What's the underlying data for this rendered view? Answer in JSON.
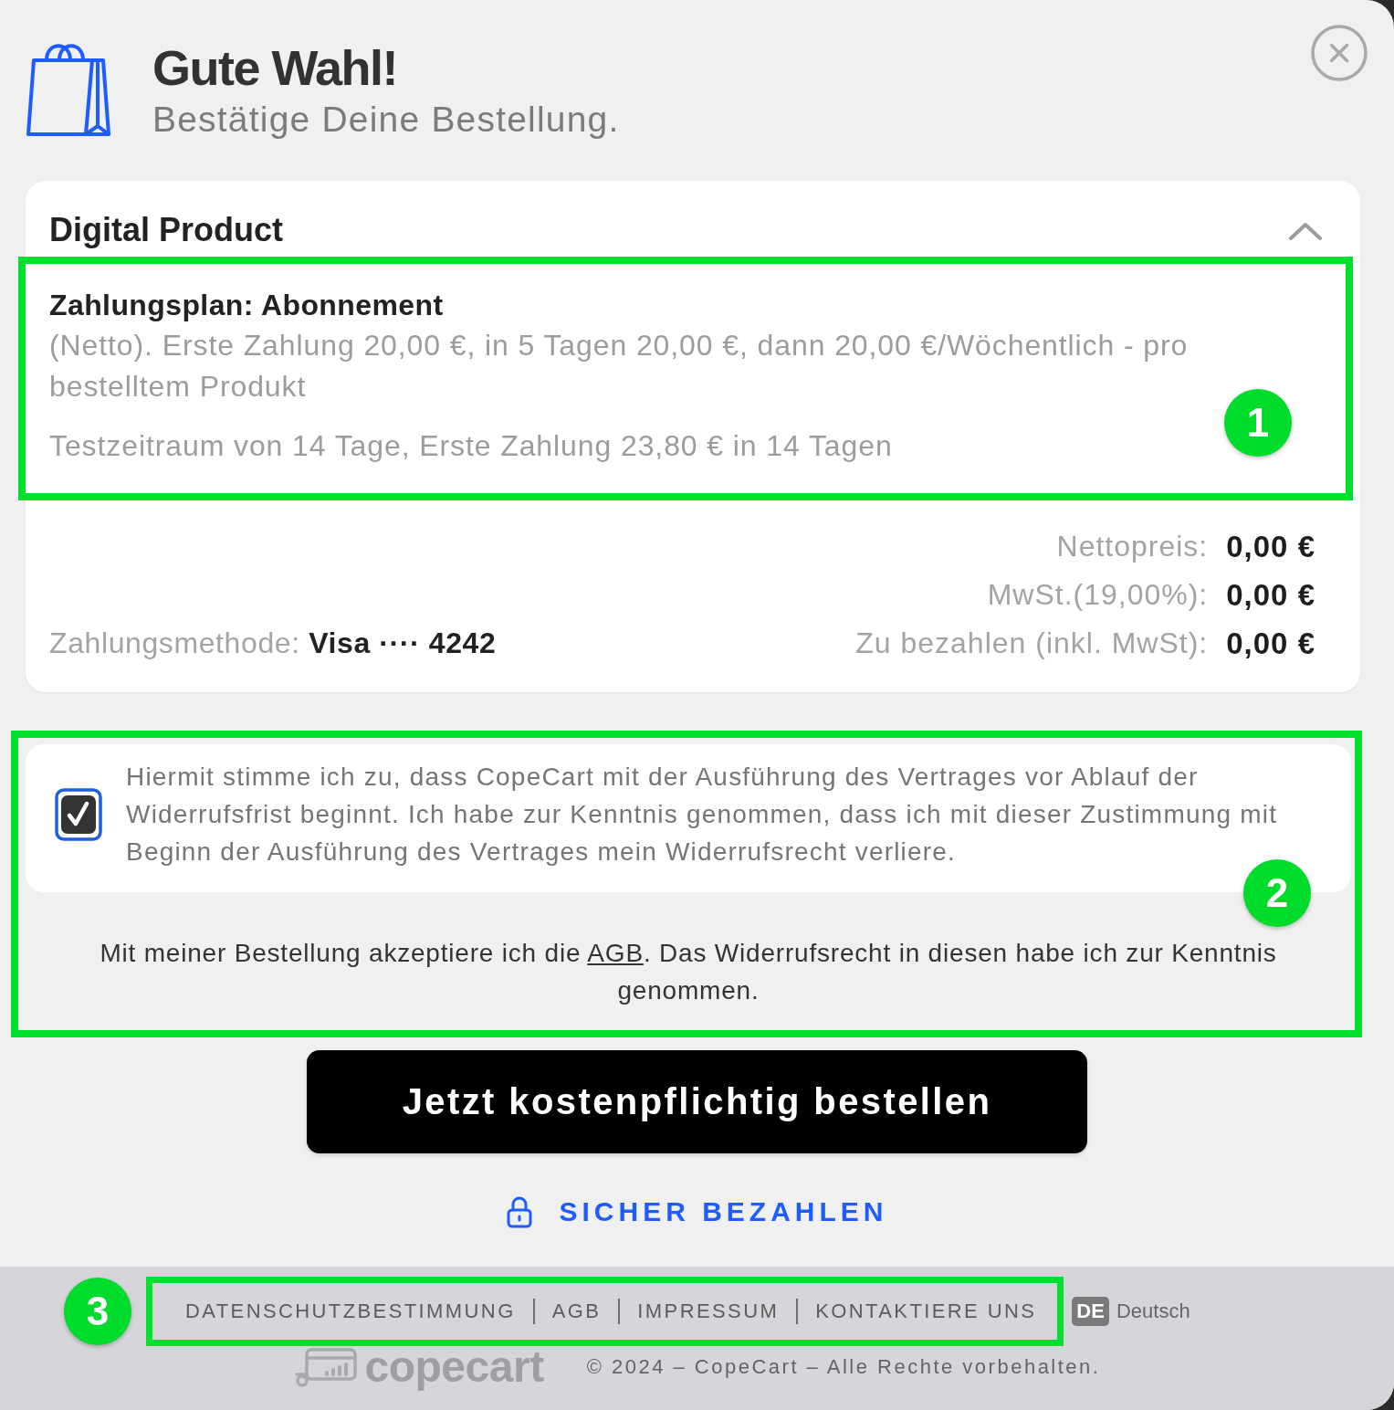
{
  "header": {
    "title": "Gute Wahl!",
    "subtitle": "Bestätige Deine Bestellung."
  },
  "product": {
    "name": "Digital Product",
    "expanded": true,
    "plan": {
      "callout": "1",
      "title": "Zahlungsplan: Abonnement",
      "description": "(Netto). Erste Zahlung 20,00 €, in 5 Tagen 20,00 €, dann 20,00 €/Wöchentlich - pro bestelltem Produkt",
      "trial": "Testzeitraum von 14 Tage, Erste Zahlung 23,80 € in 14 Tagen"
    },
    "payment_method": "Zahlungsmethode: **Visa ···· 4242**",
    "totals": [
      {
        "label": "Nettopreis:",
        "amount": "0,00 €"
      },
      {
        "label": "MwSt.(19,00%):",
        "amount": "0,00 €"
      },
      {
        "label": "Zu bezahlen (inkl. MwSt):",
        "amount": "0,00 €"
      }
    ]
  },
  "consent": {
    "callout": "2",
    "checked": true,
    "text": "Hiermit stimme ich zu, dass CopeCart mit der Ausführung des Vertrages vor Ablauf der Widerrufsfrist beginnt. Ich habe zur Kenntnis genommen, dass ich mit dieser Zustimmung mit Beginn der Ausführung des Vertrages mein Widerrufsrecht verliere.",
    "terms_before": "Mit meiner Bestellung akzeptiere ich die ",
    "terms_link": "AGB",
    "terms_after": ". Das Widerrufsrecht in diesen habe ich zur Kenntnis genommen."
  },
  "order_button": "Jetzt kostenpflichtig bestellen",
  "secure_label": "SICHER BEZAHLEN",
  "footer": {
    "callout": "3",
    "links": [
      "DATENSCHUTZBESTIMMUNG",
      "AGB",
      "IMPRESSUM",
      "KONTAKTIERE UNS"
    ],
    "language": {
      "code": "DE",
      "name": "Deutsch"
    },
    "logo_text": "copecart",
    "copyright": "© 2024 – CopeCart – Alle Rechte vorbehalten."
  }
}
